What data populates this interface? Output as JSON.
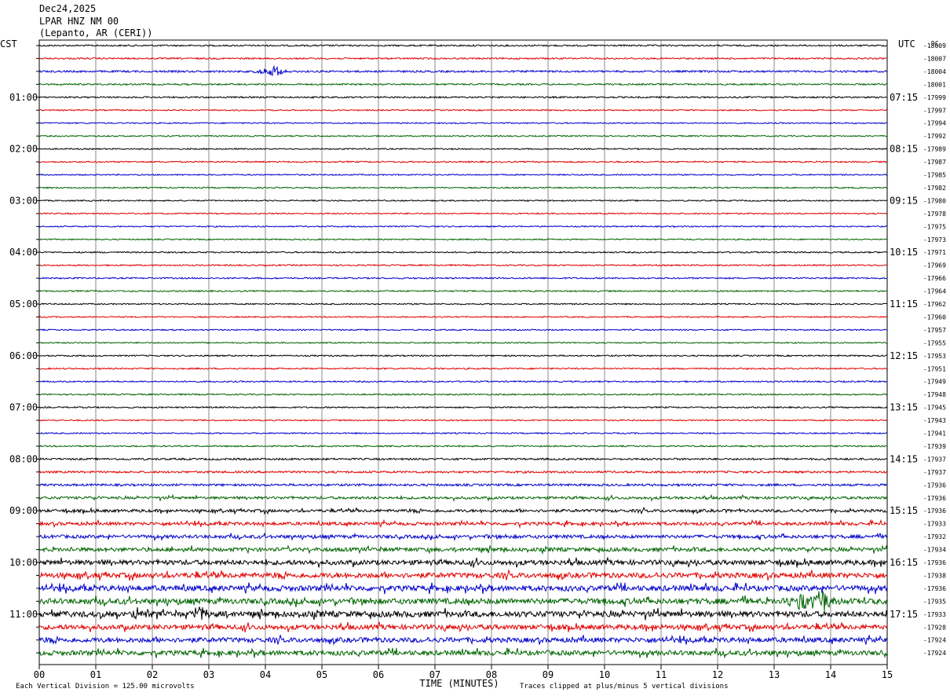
{
  "header": {
    "date": "Dec24,2025",
    "station": "LPAR HNZ NM 00",
    "location": "(Lepanto, AR (CERI))"
  },
  "footer": {
    "scale_note": "Each Vertical Division =  125.00 microvolts",
    "clip_note": "Traces clipped at plus/minus 5 vertical divisions"
  },
  "colors": {
    "trace_cycle": [
      "#000000",
      "#e00000",
      "#0000cc",
      "#006400"
    ],
    "grid": "#888888"
  },
  "chart_data": {
    "type": "line",
    "subtype": "helicorder",
    "left_timezone": "CST",
    "right_timezone": "UTC",
    "right_header": "DC",
    "xlabel": "TIME (MINUTES)",
    "x_ticks": [
      "00",
      "01",
      "02",
      "03",
      "04",
      "05",
      "06",
      "07",
      "08",
      "09",
      "10",
      "11",
      "12",
      "13",
      "14",
      "15"
    ],
    "xlim": [
      0,
      15
    ],
    "left_hour_labels": [
      "01:00",
      "02:00",
      "03:00",
      "04:00",
      "05:00",
      "06:00",
      "07:00",
      "08:00",
      "09:00",
      "10:00",
      "11:00"
    ],
    "right_hour_labels": [
      "07:15",
      "08:15",
      "09:15",
      "10:15",
      "11:15",
      "12:15",
      "13:15",
      "14:15",
      "15:15",
      "16:15",
      "17:15"
    ],
    "dc_offsets": [
      -18009,
      -18007,
      -18004,
      -18001,
      -17999,
      -17997,
      -17994,
      -17992,
      -17989,
      -17987,
      -17985,
      -17982,
      -17980,
      -17978,
      -17975,
      -17973,
      -17971,
      -17969,
      -17966,
      -17964,
      -17962,
      -17960,
      -17957,
      -17955,
      -17953,
      -17951,
      -17949,
      -17948,
      -17945,
      -17943,
      -17941,
      -17939,
      -17937,
      -17937,
      -17936,
      -17936,
      -17936,
      -17933,
      -17932,
      -17934,
      -17936,
      -17938,
      -17936,
      -17935,
      -17933,
      -17928,
      -17924,
      -17924
    ],
    "trace_amplitude_levels": [
      1,
      1,
      1.2,
      1,
      1,
      0.8,
      0.8,
      0.8,
      0.8,
      0.9,
      0.8,
      0.8,
      0.8,
      0.8,
      0.8,
      0.8,
      0.9,
      0.9,
      0.9,
      0.9,
      0.8,
      0.8,
      0.8,
      0.8,
      0.9,
      0.9,
      0.9,
      0.9,
      0.9,
      0.8,
      0.8,
      0.9,
      1.2,
      1.3,
      1.4,
      1.6,
      1.8,
      2,
      2.1,
      2.4,
      3,
      3.2,
      3.4,
      3.5,
      3.6,
      3.0,
      3.0,
      3.0
    ],
    "events": [
      {
        "trace": 2,
        "minute": 4.15,
        "amplitude": 8
      },
      {
        "trace": 43,
        "minute": 13.5,
        "amplitude": 14
      },
      {
        "trace": 43,
        "minute": 13.85,
        "amplitude": 16
      },
      {
        "trace": 44,
        "minute": 1.75,
        "amplitude": 9
      },
      {
        "trace": 44,
        "minute": 2.85,
        "amplitude": 10
      }
    ]
  }
}
